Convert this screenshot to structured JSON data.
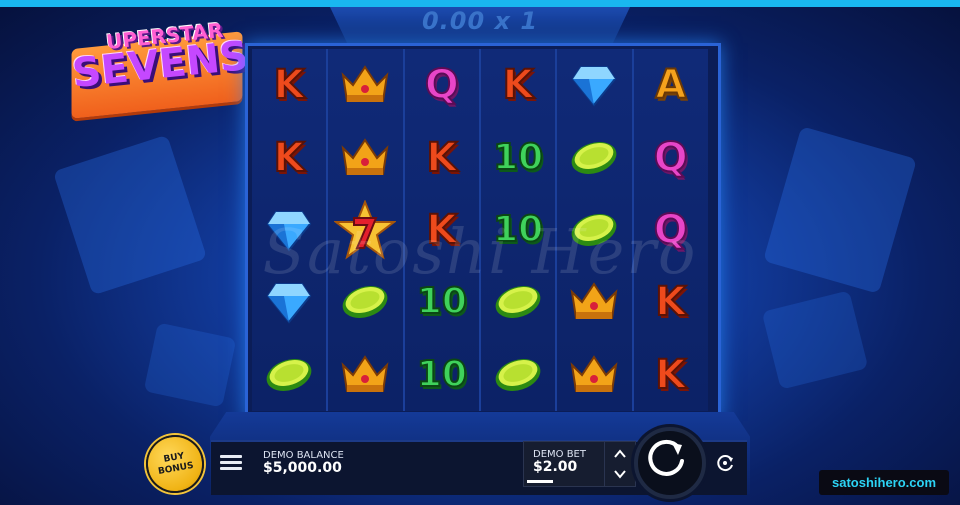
{
  "game": {
    "logo_top": "UPERSTAR",
    "logo_main": "SEVENS",
    "multiplier": "0.00 x 1",
    "watermark": "Satoshi Hero"
  },
  "reels": [
    [
      "K",
      "K",
      "diamond",
      "diamond",
      "lime"
    ],
    [
      "crown",
      "crown",
      "seven",
      "lime",
      "crown"
    ],
    [
      "Q",
      "K",
      "K",
      "10",
      "10"
    ],
    [
      "K",
      "10",
      "10",
      "lime",
      "lime"
    ],
    [
      "diamond",
      "lime",
      "lime",
      "crown",
      "crown"
    ],
    [
      "A",
      "Q",
      "Q",
      "K",
      "K"
    ]
  ],
  "controls": {
    "buy_bonus_line1": "BUY",
    "buy_bonus_line2": "BONUS",
    "balance_label": "DEMO BALANCE",
    "balance_value": "$5,000.00",
    "bet_label": "DEMO BET",
    "bet_value": "$2.00",
    "menu_icon": "hamburger-icon",
    "spin_icon": "spin-arrow-icon",
    "autoplay_icon": "autoplay-icon",
    "bet_up_icon": "chevron-up-icon",
    "bet_down_icon": "chevron-down-icon"
  },
  "site_badge": "satoshihero.com",
  "colors": {
    "accent_cyan": "#19b7f0",
    "badge_text": "#2cd3f5",
    "buy_bonus": "#f0b314"
  }
}
